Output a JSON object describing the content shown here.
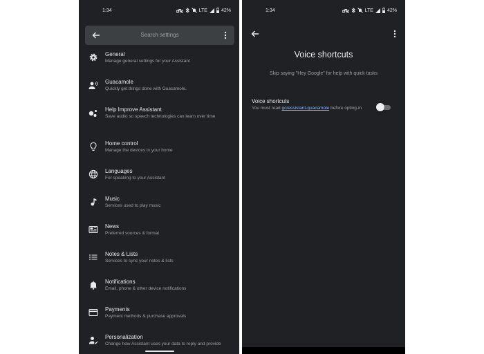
{
  "left_screen": {
    "status_bar": {
      "time": "1:34",
      "network": "LTE",
      "battery": "42%"
    },
    "search": {
      "placeholder": "Search settings"
    },
    "settings_items": [
      {
        "title": "General",
        "subtitle": "Manage general settings for your Assistant",
        "icon": "gear-icon"
      },
      {
        "title": "Guacamole",
        "subtitle": "Quickly get things done with Guacamole.",
        "icon": "voice-person-icon"
      },
      {
        "title": "Help Improve Assistant",
        "subtitle": "Save audio so speech technologies can learn over time",
        "icon": "assistant-dots-icon"
      },
      {
        "title": "Home control",
        "subtitle": "Manage the devices in your home",
        "icon": "lightbulb-icon"
      },
      {
        "title": "Languages",
        "subtitle": "For speaking to your Assistant",
        "icon": "globe-icon"
      },
      {
        "title": "Music",
        "subtitle": "Services used to play music",
        "icon": "music-note-icon"
      },
      {
        "title": "News",
        "subtitle": "Preferred sources & format",
        "icon": "news-icon"
      },
      {
        "title": "Notes & Lists",
        "subtitle": "Services to sync your notes & lists",
        "icon": "list-icon"
      },
      {
        "title": "Notifications",
        "subtitle": "Email, phone & other device notifications",
        "icon": "bell-icon"
      },
      {
        "title": "Payments",
        "subtitle": "Payment methods & purchase approvals",
        "icon": "credit-card-icon"
      },
      {
        "title": "Personalization",
        "subtitle": "Change how Assistant uses your data to reply and provide",
        "icon": "person-check-icon"
      }
    ]
  },
  "right_screen": {
    "status_bar": {
      "time": "1:34",
      "network": "LTE",
      "battery": "42%"
    },
    "page_title": "Voice shortcuts",
    "description": "Skip saying \"Hey Google\" for help with quick tasks",
    "setting": {
      "label": "Voice shortcuts",
      "sub_prefix": "You must read",
      "link": "go/assistant-guacamole",
      "sub_suffix": "before opting-in",
      "toggle_on": false
    }
  }
}
